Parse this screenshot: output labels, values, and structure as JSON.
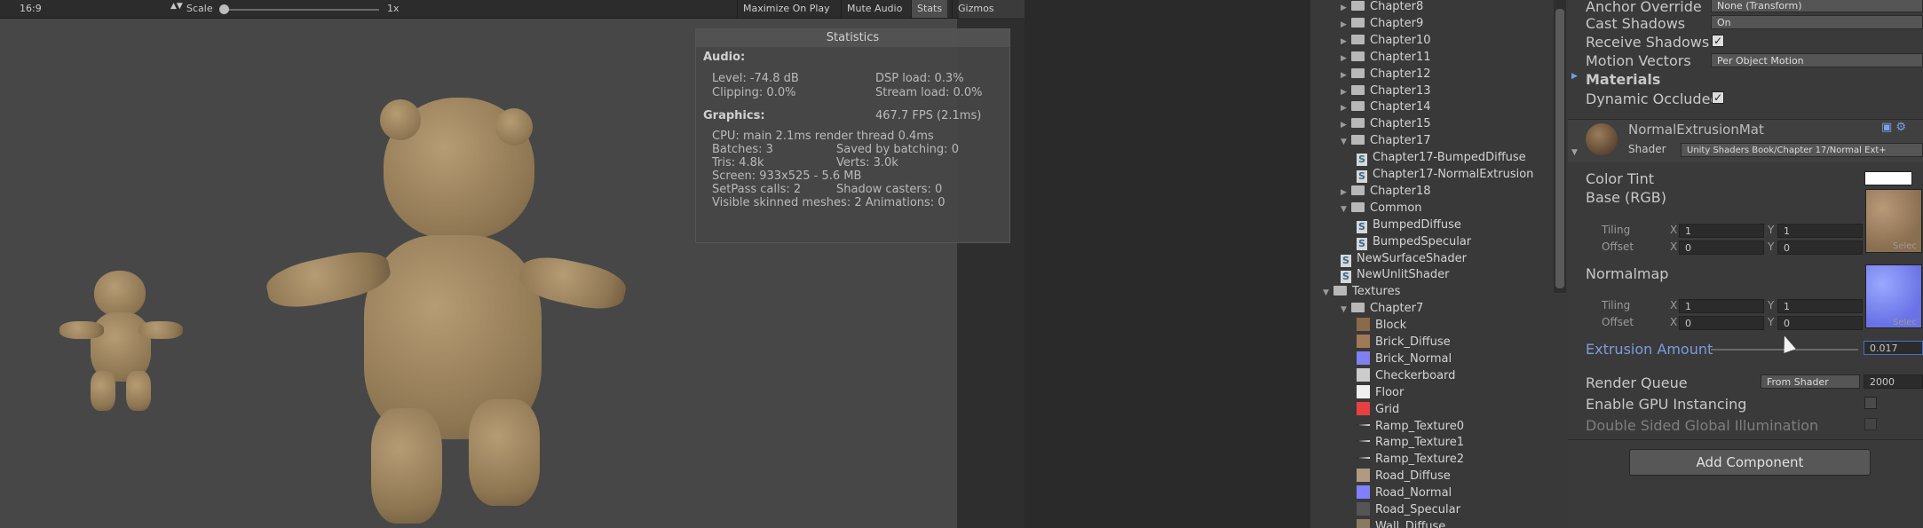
{
  "game": {
    "aspect": "16:9",
    "scale_label": "Scale",
    "scale_value": "1x",
    "buttons": {
      "maximize": "Maximize On Play",
      "mute": "Mute Audio",
      "stats": "Stats",
      "gizmos": "Gizmos"
    }
  },
  "statistics": {
    "title": "Statistics",
    "audio_header": "Audio:",
    "level": "Level: -74.8 dB",
    "clipping": "Clipping: 0.0%",
    "dsp_load": "DSP load: 0.3%",
    "stream_load": "Stream load: 0.0%",
    "graphics_header": "Graphics:",
    "fps": "467.7 FPS (2.1ms)",
    "cpu": "CPU: main 2.1ms  render thread 0.4ms",
    "batches": "Batches: 3",
    "saved_batching": "Saved by batching: 0",
    "tris": "Tris: 4.8k",
    "verts": "Verts: 3.0k",
    "screen": "Screen: 933x525 - 5.6 MB",
    "setpass": "SetPass calls: 2",
    "shadow_casters": "Shadow casters: 0",
    "skinned": "Visible skinned meshes: 2  Animations: 0"
  },
  "project": {
    "items": [
      {
        "label": "Chapter8",
        "type": "folder",
        "depth": 1,
        "expanded": false
      },
      {
        "label": "Chapter9",
        "type": "folder",
        "depth": 1,
        "expanded": false
      },
      {
        "label": "Chapter10",
        "type": "folder",
        "depth": 1,
        "expanded": false
      },
      {
        "label": "Chapter11",
        "type": "folder",
        "depth": 1,
        "expanded": false
      },
      {
        "label": "Chapter12",
        "type": "folder",
        "depth": 1,
        "expanded": false
      },
      {
        "label": "Chapter13",
        "type": "folder",
        "depth": 1,
        "expanded": false
      },
      {
        "label": "Chapter14",
        "type": "folder",
        "depth": 1,
        "expanded": false
      },
      {
        "label": "Chapter15",
        "type": "folder",
        "depth": 1,
        "expanded": false
      },
      {
        "label": "Chapter17",
        "type": "folder",
        "depth": 1,
        "expanded": true
      },
      {
        "label": "Chapter17-BumpedDiffuse",
        "type": "shader",
        "depth": 2
      },
      {
        "label": "Chapter17-NormalExtrusion",
        "type": "shader",
        "depth": 2
      },
      {
        "label": "Chapter18",
        "type": "folder",
        "depth": 1,
        "expanded": false
      },
      {
        "label": "Common",
        "type": "folder",
        "depth": 1,
        "expanded": true
      },
      {
        "label": "BumpedDiffuse",
        "type": "shader",
        "depth": 2
      },
      {
        "label": "BumpedSpecular",
        "type": "shader",
        "depth": 2
      },
      {
        "label": "NewSurfaceShader",
        "type": "shader",
        "depth": 1
      },
      {
        "label": "NewUnlitShader",
        "type": "shader",
        "depth": 1
      },
      {
        "label": "Textures",
        "type": "folder",
        "depth": 0,
        "expanded": true
      },
      {
        "label": "Chapter7",
        "type": "folder",
        "depth": 1,
        "expanded": true
      },
      {
        "label": "Block",
        "type": "texture",
        "depth": 2,
        "color": "#8a6a4a"
      },
      {
        "label": "Brick_Diffuse",
        "type": "texture",
        "depth": 2,
        "color": "#a07a55"
      },
      {
        "label": "Brick_Normal",
        "type": "texture",
        "depth": 2,
        "color": "#8080f0"
      },
      {
        "label": "Checkerboard",
        "type": "texture",
        "depth": 2,
        "color": "#cccccc"
      },
      {
        "label": "Floor",
        "type": "texture",
        "depth": 2,
        "color": "#f0f0f0"
      },
      {
        "label": "Grid",
        "type": "texture",
        "depth": 2,
        "color": "#e84040"
      },
      {
        "label": "Ramp_Texture0",
        "type": "ramp",
        "depth": 2
      },
      {
        "label": "Ramp_Texture1",
        "type": "ramp",
        "depth": 2
      },
      {
        "label": "Ramp_Texture2",
        "type": "ramp",
        "depth": 2
      },
      {
        "label": "Road_Diffuse",
        "type": "texture",
        "depth": 2,
        "color": "#b09a80"
      },
      {
        "label": "Road_Normal",
        "type": "texture",
        "depth": 2,
        "color": "#8080ff"
      },
      {
        "label": "Road_Specular",
        "type": "texture",
        "depth": 2,
        "color": "#555555"
      },
      {
        "label": "Wall_Diffuse",
        "type": "texture",
        "depth": 2,
        "color": "#8a7a60"
      }
    ]
  },
  "inspector": {
    "anchor_override": {
      "label": "Anchor Override",
      "value": "None (Transform)"
    },
    "cast_shadows": {
      "label": "Cast Shadows",
      "value": "On"
    },
    "receive_shadows": {
      "label": "Receive Shadows"
    },
    "motion_vectors": {
      "label": "Motion Vectors",
      "value": "Per Object Motion"
    },
    "materials_label": "Materials",
    "dynamic_occluded": {
      "label": "Dynamic Occluded"
    },
    "material": {
      "name": "NormalExtrusionMat",
      "shader_label": "Shader",
      "shader_value": "Unity Shaders Book/Chapter 17/Normal Ext+",
      "color_tint": "Color Tint",
      "base": "Base (RGB)",
      "tiling": "Tiling",
      "offset": "Offset",
      "x": "X",
      "y": "Y",
      "base_tiling_x": "1",
      "base_tiling_y": "1",
      "base_offset_x": "0",
      "base_offset_y": "0",
      "normalmap": "Normalmap",
      "normal_tiling_x": "1",
      "normal_tiling_y": "1",
      "normal_offset_x": "0",
      "normal_offset_y": "0",
      "select": "Selec",
      "extrusion_label": "Extrusion Amount",
      "extrusion_value": "0.017",
      "render_queue_label": "Render Queue",
      "render_queue_mode": "From Shader",
      "render_queue_value": "2000",
      "gpu_instancing": "Enable GPU Instancing",
      "double_sided": "Double Sided Global Illumination"
    },
    "add_component": "Add Component"
  },
  "colors": {
    "accent_link": "#7b9ce0",
    "material_blue": "#7890f0"
  }
}
